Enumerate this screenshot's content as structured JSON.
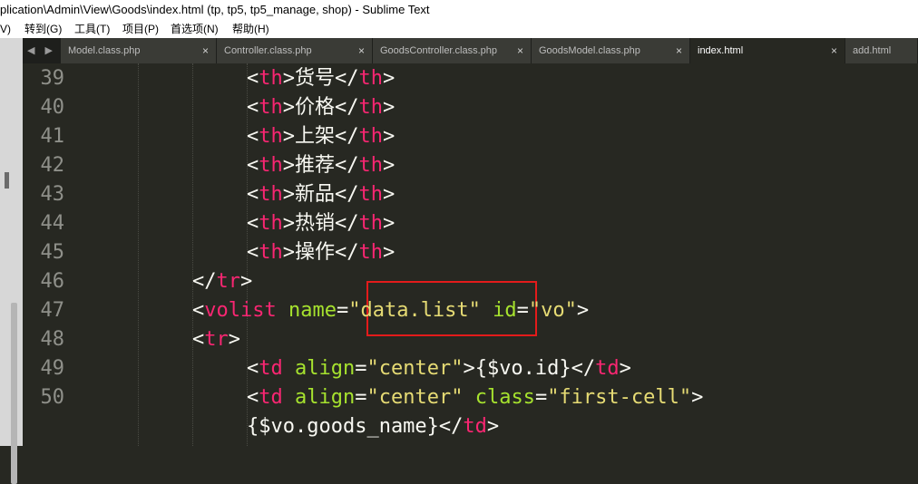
{
  "window": {
    "title": "plication\\Admin\\View\\Goods\\index.html (tp, tp5, tp5_manage, shop) - Sublime Text"
  },
  "menu": {
    "items": [
      "V)",
      "转到(G)",
      "工具(T)",
      "项目(P)",
      "首选项(N)",
      "帮助(H)"
    ]
  },
  "tabs": [
    {
      "label": "Model.class.php",
      "active": false
    },
    {
      "label": "Controller.class.php",
      "active": false
    },
    {
      "label": "GoodsController.class.php",
      "active": false
    },
    {
      "label": "GoodsModel.class.php",
      "active": false
    },
    {
      "label": "index.html",
      "active": true
    },
    {
      "label": "add.html",
      "active": false
    }
  ],
  "tab_close_glyph": "×",
  "nav_arrows": "◀ ▶",
  "colors": {
    "background": "#272822",
    "tag": "#f92672",
    "attribute": "#a6e22e",
    "string": "#e6db74",
    "text": "#f8f8f2",
    "line_number": "#8f908a",
    "highlight_box": "#e31b1b"
  },
  "editor": {
    "lines": [
      {
        "num": "39",
        "tokens": [
          [
            "p",
            "<"
          ],
          [
            "t",
            "th"
          ],
          [
            "p",
            ">货号</"
          ],
          [
            "t",
            "th"
          ],
          [
            "p",
            ">"
          ]
        ]
      },
      {
        "num": "40",
        "tokens": [
          [
            "p",
            "<"
          ],
          [
            "t",
            "th"
          ],
          [
            "p",
            ">价格</"
          ],
          [
            "t",
            "th"
          ],
          [
            "p",
            ">"
          ]
        ]
      },
      {
        "num": "41",
        "tokens": [
          [
            "p",
            "<"
          ],
          [
            "t",
            "th"
          ],
          [
            "p",
            ">上架</"
          ],
          [
            "t",
            "th"
          ],
          [
            "p",
            ">"
          ]
        ]
      },
      {
        "num": "42",
        "tokens": [
          [
            "p",
            "<"
          ],
          [
            "t",
            "th"
          ],
          [
            "p",
            ">推荐</"
          ],
          [
            "t",
            "th"
          ],
          [
            "p",
            ">"
          ]
        ]
      },
      {
        "num": "43",
        "tokens": [
          [
            "p",
            "<"
          ],
          [
            "t",
            "th"
          ],
          [
            "p",
            ">新品</"
          ],
          [
            "t",
            "th"
          ],
          [
            "p",
            ">"
          ]
        ]
      },
      {
        "num": "44",
        "tokens": [
          [
            "p",
            "<"
          ],
          [
            "t",
            "th"
          ],
          [
            "p",
            ">热销</"
          ],
          [
            "t",
            "th"
          ],
          [
            "p",
            ">"
          ]
        ]
      },
      {
        "num": "45",
        "tokens": [
          [
            "p",
            "<"
          ],
          [
            "t",
            "th"
          ],
          [
            "p",
            ">操作</"
          ],
          [
            "t",
            "th"
          ],
          [
            "p",
            ">"
          ]
        ]
      },
      {
        "num": "46",
        "tokens": [
          [
            "p",
            "</"
          ],
          [
            "t",
            "tr"
          ],
          [
            "p",
            ">"
          ]
        ]
      },
      {
        "num": "47",
        "tokens": [
          [
            "p",
            "<"
          ],
          [
            "t",
            "volist"
          ],
          [
            "p",
            " "
          ],
          [
            "a",
            "name"
          ],
          [
            "p",
            "="
          ],
          [
            "s",
            "\"data.list\""
          ],
          [
            "p",
            " "
          ],
          [
            "a",
            "id"
          ],
          [
            "p",
            "="
          ],
          [
            "s",
            "\"vo\""
          ],
          [
            "p",
            ">"
          ]
        ]
      },
      {
        "num": "48",
        "tokens": [
          [
            "p",
            "<"
          ],
          [
            "t",
            "tr"
          ],
          [
            "p",
            ">"
          ]
        ]
      },
      {
        "num": "49",
        "tokens": [
          [
            "p",
            "<"
          ],
          [
            "t",
            "td"
          ],
          [
            "p",
            " "
          ],
          [
            "a",
            "align"
          ],
          [
            "p",
            "="
          ],
          [
            "s",
            "\"center\""
          ],
          [
            "p",
            ">{$vo.id}</"
          ],
          [
            "t",
            "td"
          ],
          [
            "p",
            ">"
          ]
        ]
      },
      {
        "num": "50",
        "tokens": [
          [
            "p",
            "<"
          ],
          [
            "t",
            "td"
          ],
          [
            "p",
            " "
          ],
          [
            "a",
            "align"
          ],
          [
            "p",
            "="
          ],
          [
            "s",
            "\"center\""
          ],
          [
            "p",
            " "
          ],
          [
            "a",
            "class"
          ],
          [
            "p",
            "="
          ],
          [
            "s",
            "\"first-cell\""
          ],
          [
            "p",
            ">"
          ]
        ]
      },
      {
        "num": "",
        "tokens": [
          [
            "p",
            "{$vo.goods_name}</"
          ],
          [
            "t",
            "td"
          ],
          [
            "p",
            ">"
          ]
        ]
      }
    ]
  }
}
